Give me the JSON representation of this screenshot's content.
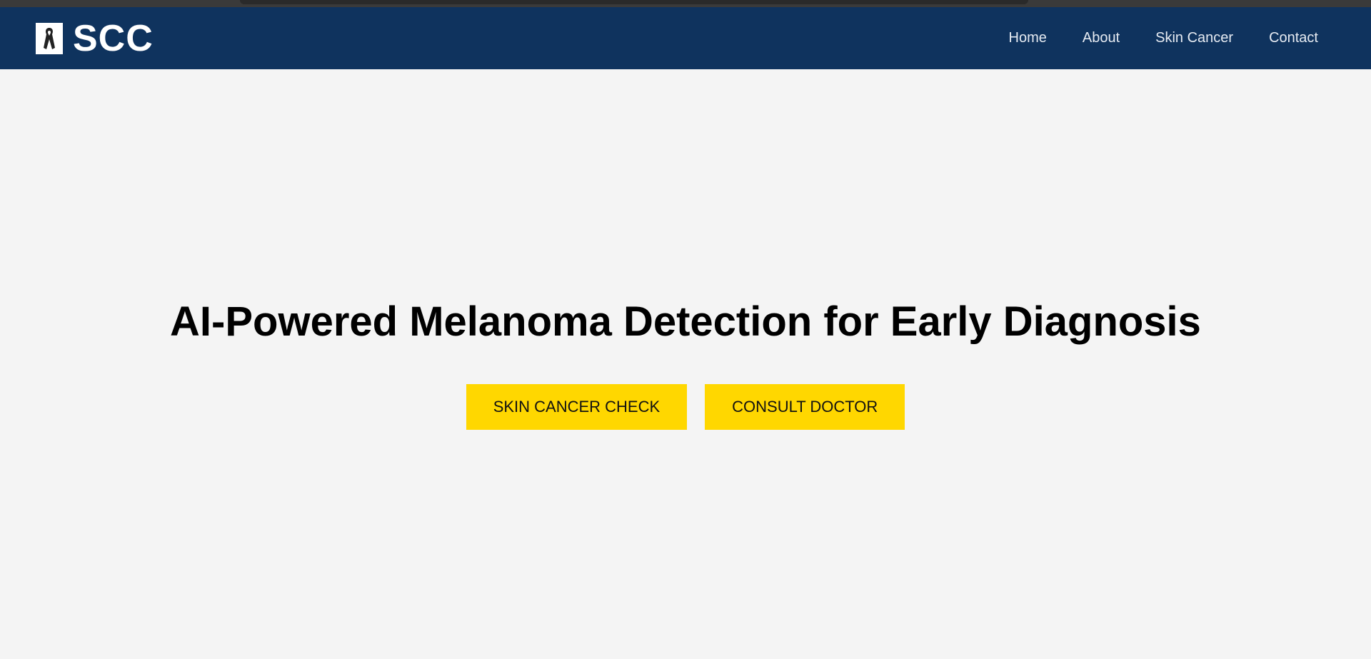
{
  "brand": {
    "logo_icon": "awareness-ribbon-icon",
    "name": "SCC"
  },
  "nav": {
    "items": [
      {
        "label": "Home"
      },
      {
        "label": "About"
      },
      {
        "label": "Skin Cancer"
      },
      {
        "label": "Contact"
      }
    ]
  },
  "hero": {
    "title": "AI-Powered Melanoma Detection for Early Diagnosis",
    "buttons": {
      "check_label": "SKIN CANCER CHECK",
      "consult_label": "CONSULT DOCTOR"
    }
  },
  "colors": {
    "navbar_bg": "#0f335e",
    "page_bg": "#f4f4f4",
    "button_bg": "#ffd700"
  }
}
